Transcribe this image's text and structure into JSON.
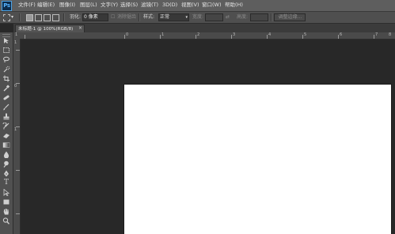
{
  "app": {
    "logo": "Ps"
  },
  "menu": [
    "文件(F)",
    "编辑(E)",
    "图像(I)",
    "图层(L)",
    "文字(Y)",
    "选择(S)",
    "滤镜(T)",
    "3D(D)",
    "视图(V)",
    "窗口(W)",
    "帮助(H)"
  ],
  "options": {
    "feather_label": "羽化:",
    "feather_value": "0 像素",
    "antialias_label": "消除锯齿",
    "style_label": "样式:",
    "style_value": "正常",
    "width_label": "宽度:",
    "height_label": "高度:",
    "refine_edge": "调整边缘..."
  },
  "document": {
    "tab_title": "未标题-1 @ 100%(RGB/8)",
    "tab_close": "×"
  },
  "ruler": {
    "top_ticks": [
      "1",
      "0",
      "1",
      "2",
      "3",
      "4",
      "5",
      "6",
      "7",
      "8"
    ],
    "left_ticks": [
      "1",
      "0",
      "1"
    ]
  },
  "icons": {
    "move": "move-icon",
    "marquee": "rect-marquee-icon",
    "lasso": "lasso-icon",
    "quick_select": "quick-select-icon",
    "crop": "crop-icon",
    "eyedropper": "eyedropper-icon",
    "healing": "healing-brush-icon",
    "brush": "brush-icon",
    "stamp": "clone-stamp-icon",
    "history_brush": "history-brush-icon",
    "eraser": "eraser-icon",
    "gradient": "gradient-icon",
    "blur": "blur-icon",
    "dodge": "dodge-icon",
    "pen": "pen-icon",
    "type": "type-icon",
    "path_select": "path-select-icon",
    "shape": "rectangle-shape-icon",
    "hand": "hand-icon",
    "zoom": "zoom-icon"
  },
  "colors": {
    "accent": "#4fa4e6",
    "canvas": "#ffffff",
    "workspace": "#282828"
  }
}
